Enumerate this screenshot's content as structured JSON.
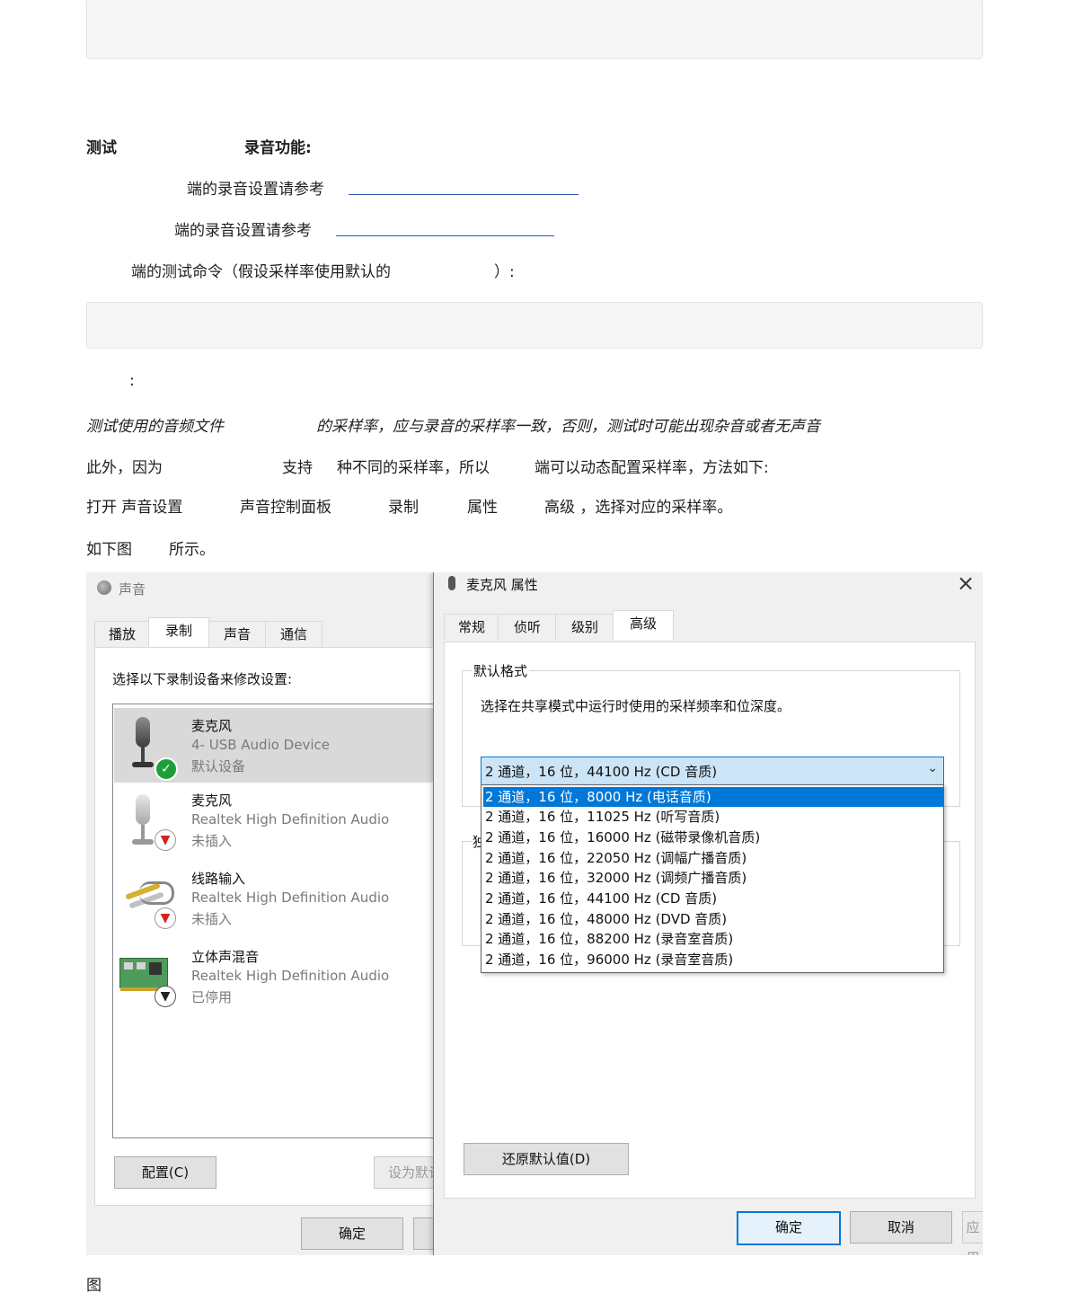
{
  "doc": {
    "heading_left": "测试",
    "heading_right": "录音功能:",
    "line1": "端的录音设置请参考",
    "line2": "端的录音设置请参考",
    "line3_a": "端的测试命令（假设采样率使用默认的",
    "line3_b": "）:",
    "note_colon": ":",
    "note_italic_a": "测试使用的音频文件",
    "note_italic_b": "的采样率，应与录音的采样率一致，否则，测试时可能出现杂音或者无声音",
    "para_a": "此外，因为",
    "para_b": "支持",
    "para_c": "种不同的采样率，所以",
    "para_d": "端可以动态配置采样率，方法如下:",
    "steps_a": "打开 声音设置",
    "steps_b": "声音控制面板",
    "steps_c": "录制",
    "steps_d": "属性",
    "steps_e": "高级 ，选择对应的采样率。",
    "fig_ref_a": "如下图",
    "fig_ref_b": "所示。",
    "caption": "图"
  },
  "sound_dialog": {
    "title": "声音",
    "tabs": [
      "播放",
      "录制",
      "声音",
      "通信"
    ],
    "instruction": "选择以下录制设备来修改设置:",
    "devices": [
      {
        "name": "麦克风",
        "detail": "4- USB Audio Device",
        "status": "默认设备"
      },
      {
        "name": "麦克风",
        "detail": "Realtek High Definition Audio",
        "status": "未插入"
      },
      {
        "name": "线路输入",
        "detail": "Realtek High Definition Audio",
        "status": "未插入"
      },
      {
        "name": "立体声混音",
        "detail": "Realtek High Definition Audio",
        "status": "已停用"
      }
    ],
    "configure_btn": "配置(C)",
    "set_default_btn": "设为默认",
    "ok_btn": "确定"
  },
  "props_dialog": {
    "title": "麦克风 属性",
    "close": "×",
    "tabs": [
      "常规",
      "侦听",
      "级别",
      "高级"
    ],
    "group_label": "默认格式",
    "group_desc": "选择在共享模式中运行时使用的采样频率和位深度。",
    "selected_value": "2 通道，16 位，44100 Hz (CD 音质)",
    "options": [
      "2 通道，16 位，8000 Hz (电话音质)",
      "2 通道，16 位，11025 Hz (听写音质)",
      "2 通道，16 位，16000 Hz (磁带录像机音质)",
      "2 通道，16 位，22050 Hz (调幅广播音质)",
      "2 通道，16 位，32000 Hz (调频广播音质)",
      "2 通道，16 位，44100 Hz (CD 音质)",
      "2 通道，16 位，48000 Hz (DVD 音质)",
      "2 通道，16 位，88200 Hz (录音室音质)",
      "2 通道，16 位，96000 Hz (录音室音质)"
    ],
    "hidden_group_char": "独",
    "restore_btn": "还原默认值(D)",
    "ok_btn": "确定",
    "cancel_btn": "取消",
    "apply_btn": "应用(A)"
  },
  "colors": {
    "accent": "#0078d7",
    "link": "#2a5db0",
    "check": "#1e9e3a",
    "disabled_arrow": "#d42020"
  }
}
